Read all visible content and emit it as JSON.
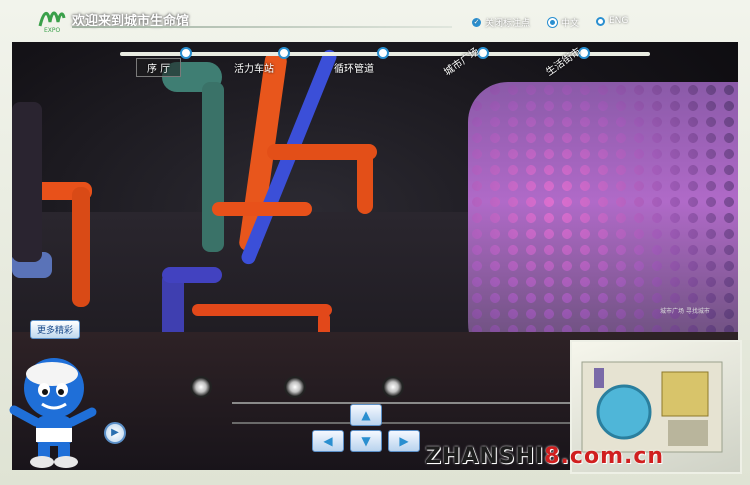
{
  "header": {
    "title": "欢迎来到城市生命馆",
    "options": [
      {
        "label": "关闭标注点",
        "kind": "toggle"
      },
      {
        "label": "中文",
        "kind": "language"
      },
      {
        "label": "ENG",
        "kind": "language"
      }
    ]
  },
  "nav": {
    "stops": [
      "序 厅",
      "活力车站",
      "循环管道",
      "城市广场",
      "生活街市"
    ]
  },
  "scene": {
    "more_button": "更多精彩",
    "sign_text": "城市广场 寻找城市"
  },
  "watermark": {
    "text_main": "ZHANSHI",
    "text_red": "8.com.cn"
  },
  "colors": {
    "accent": "#2a8fd0",
    "pipe_orange": "#e8511a",
    "pipe_blue": "#3b4fd8",
    "wall_pink": "#c864c8"
  },
  "icons": {
    "play": "play-icon",
    "arrows": [
      "arrow-up-icon",
      "arrow-left-icon",
      "arrow-down-icon",
      "arrow-right-icon"
    ]
  }
}
